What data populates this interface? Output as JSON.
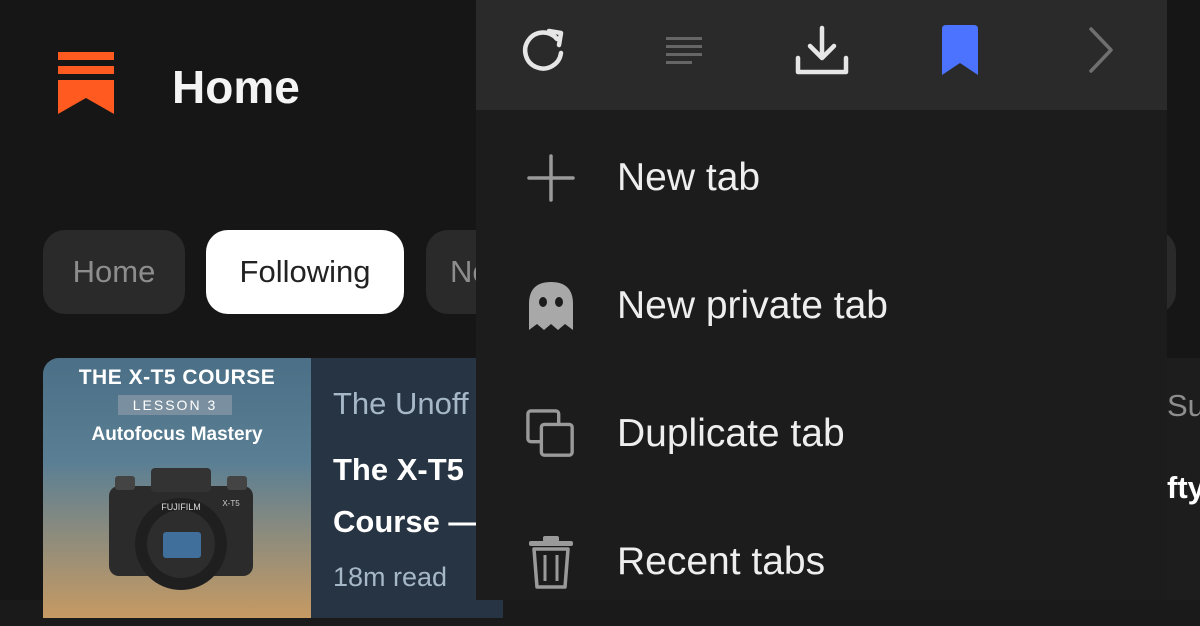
{
  "header": {
    "title": "Home"
  },
  "feed_tabs": [
    {
      "label": "Home",
      "active": false
    },
    {
      "label": "Following",
      "active": true
    },
    {
      "label": "No",
      "active": false
    }
  ],
  "post": {
    "thumbnail": {
      "course_title": "THE X-T5 COURSE",
      "lesson": "LESSON 3",
      "subtitle": "Autofocus Mastery",
      "camera_brand": "FUJIFILM",
      "camera_model": "X-T5"
    },
    "publication": "The Unoff",
    "title_line1": "The X-T5",
    "title_line2": "Course —",
    "read_time": "18m read"
  },
  "right_post": {
    "publication": "Su",
    "title": "fty"
  },
  "menu": {
    "toolbar": {
      "reload_icon": "reload-icon",
      "reader_icon": "reader-mode-icon",
      "download_icon": "download-icon",
      "bookmark_icon": "bookmark-icon",
      "forward_icon": "chevron-right-icon"
    },
    "items": [
      {
        "label": "New tab",
        "icon": "plus-icon"
      },
      {
        "label": "New private tab",
        "icon": "ghost-icon"
      },
      {
        "label": "Duplicate tab",
        "icon": "duplicate-icon"
      },
      {
        "label": "Recent tabs",
        "icon": "trash-icon"
      }
    ]
  },
  "colors": {
    "brand_orange": "#ff5a1f",
    "bookmark_blue": "#4b73ff",
    "background": "#161616",
    "menu_bg": "#1c1c1c",
    "toolbar_bg": "#2a2a2a"
  }
}
